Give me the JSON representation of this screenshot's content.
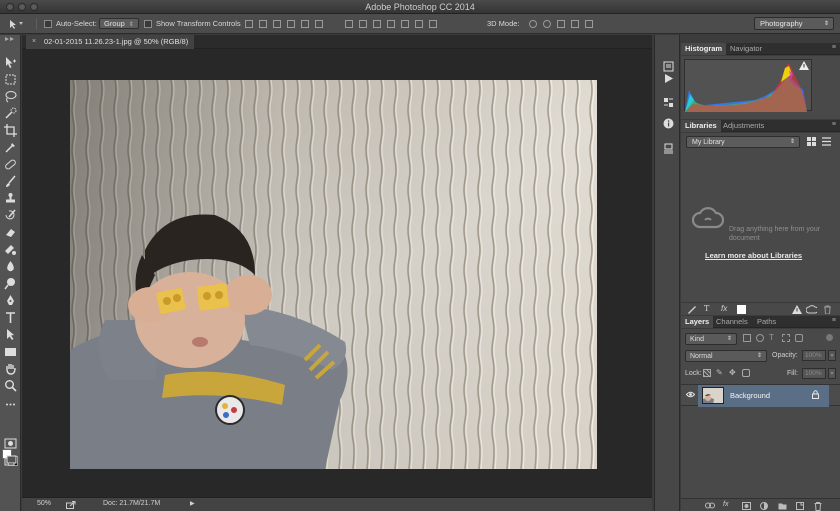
{
  "app": {
    "title": "Adobe Photoshop CC 2014"
  },
  "options_bar": {
    "auto_select_label": "Auto-Select:",
    "auto_select_value": "Group",
    "show_transform_label": "Show Transform Controls",
    "mode_3d_label": "3D Mode:",
    "workspace": "Photography"
  },
  "document": {
    "tab_title": "02-01-2015 11.26.23-1.jpg @ 50% (RGB/8)",
    "close_glyph": "×"
  },
  "status_bar": {
    "zoom": "50%",
    "doc_info": "Doc: 21.7M/21.7M"
  },
  "tools": [
    "move-tool-icon",
    "marquee-tool-icon",
    "lasso-tool-icon",
    "quick-select-tool-icon",
    "crop-tool-icon",
    "eyedropper-tool-icon",
    "healing-brush-tool-icon",
    "brush-tool-icon",
    "clone-stamp-tool-icon",
    "history-brush-tool-icon",
    "eraser-tool-icon",
    "gradient-tool-icon",
    "blur-tool-icon",
    "dodge-tool-icon",
    "pen-tool-icon",
    "type-tool-icon",
    "path-select-tool-icon",
    "rectangle-tool-icon",
    "hand-tool-icon",
    "zoom-tool-icon"
  ],
  "histogram_panel": {
    "tabs": [
      "Histogram",
      "Navigator"
    ],
    "colors": {
      "red": "#ff2a2a",
      "green": "#39d23a",
      "blue": "#2f7dff",
      "yellow": "#f2e200",
      "cyan": "#21d7e0",
      "magenta": "#e236c8"
    }
  },
  "libraries_panel": {
    "tabs": [
      "Libraries",
      "Adjustments"
    ],
    "library_select": "My Library",
    "empty_message": "Drag anything here from your document",
    "learn_link": "Learn more about Libraries"
  },
  "layers_panel": {
    "tabs": [
      "Layers",
      "Channels",
      "Paths"
    ],
    "filter_kind": "Kind",
    "blend_mode": "Normal",
    "opacity_label": "Opacity:",
    "opacity_value": "100%",
    "lock_label": "Lock:",
    "fill_label": "Fill:",
    "fill_value": "100%",
    "layers": [
      {
        "name": "Background",
        "selected": true,
        "locked": true,
        "visible": true
      }
    ],
    "selection_color": "#5a6e86"
  },
  "glyphs": {
    "down_arrow": "▾",
    "up_down": "⇕",
    "panel_menu": "≡",
    "eye": "◉",
    "lock": "🔒",
    "play": "▶",
    "fx": "fx"
  }
}
